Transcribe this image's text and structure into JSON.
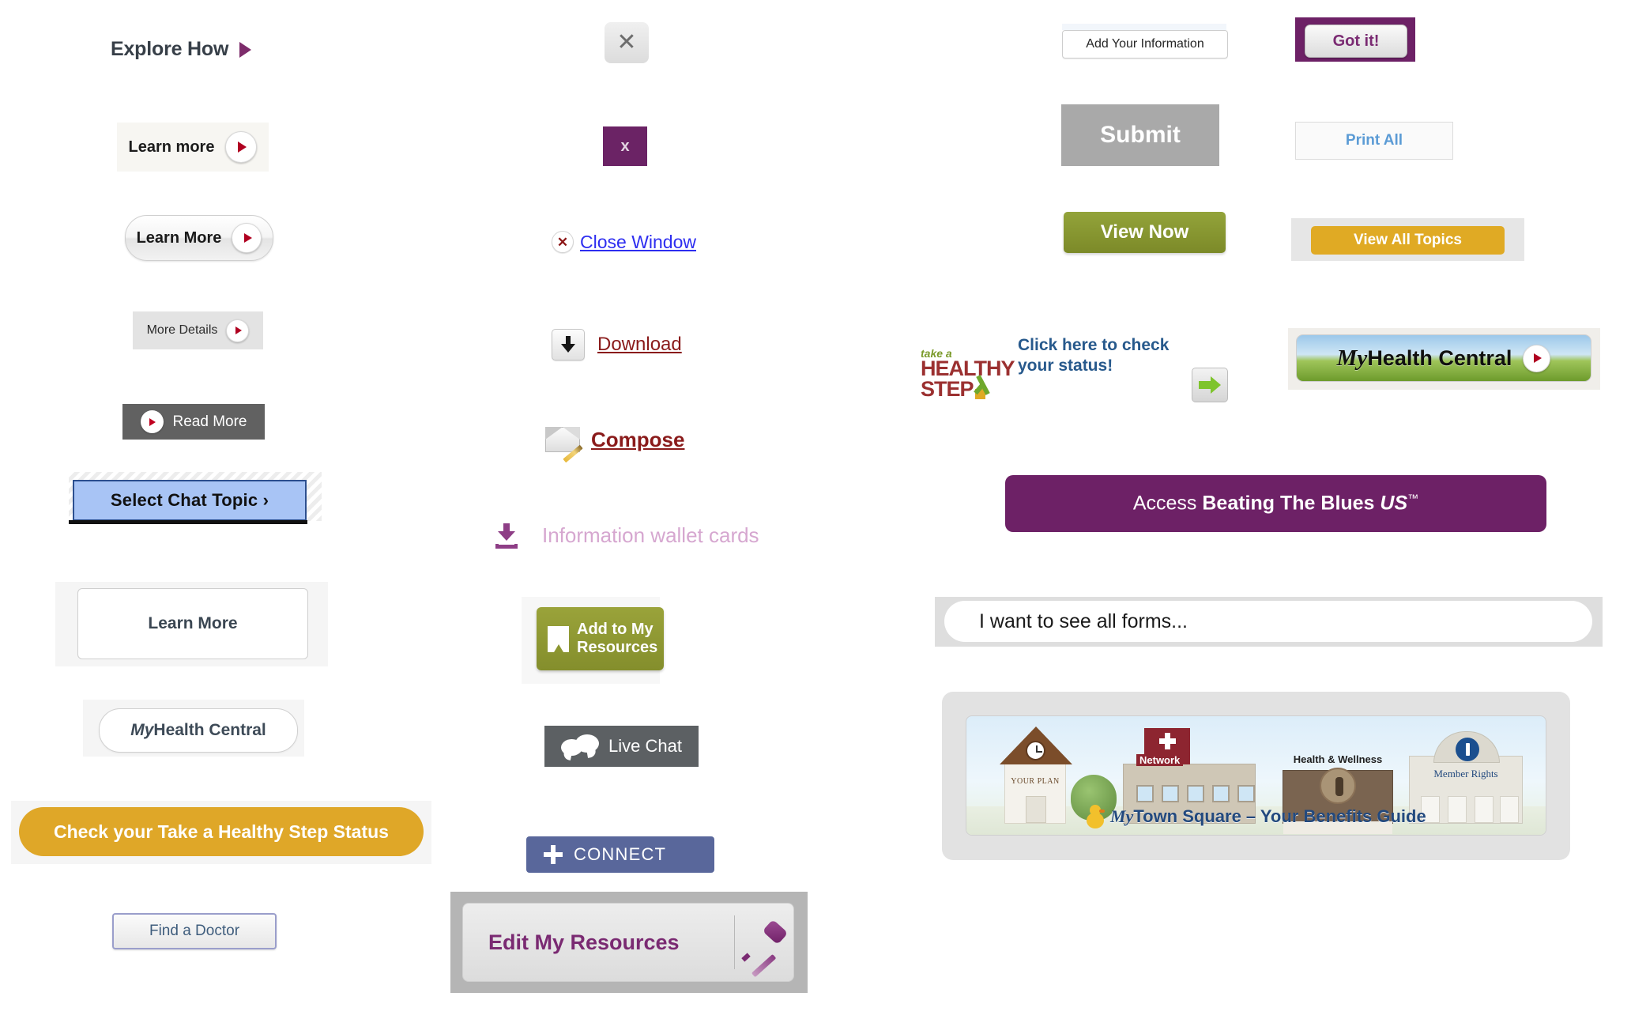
{
  "left_column": {
    "explore_how": {
      "label": "Explore How",
      "arrow_icon": "triangle-right-icon",
      "arrow_color": "#7d2c6b"
    },
    "learn_more_flat": {
      "label": "Learn more",
      "icon": "play-circle-icon",
      "bg": "#f7f6f2"
    },
    "learn_more_pill": {
      "label": "Learn More",
      "icon": "play-circle-icon"
    },
    "more_details": {
      "label": "More Details",
      "icon": "play-circle-icon",
      "bg": "#e3e3e3"
    },
    "read_more": {
      "label": "Read More",
      "icon": "play-circle-icon",
      "bg": "#616161"
    },
    "select_chat_topic": {
      "label": "Select Chat Topic ›",
      "bg": "#a8c4f5",
      "border": "#2c4f8f"
    },
    "learn_more_boxed": {
      "label": "Learn More"
    },
    "myhealth_central_pill": {
      "label_italic": "My",
      "label_rest": "Health Central"
    },
    "healthy_step_status": {
      "label": "Check your Take a Healthy Step Status",
      "bg": "#dfa728"
    },
    "find_a_doctor": {
      "label": "Find a Doctor",
      "border": "#9a9ecb",
      "text_color": "#3f5d7d"
    }
  },
  "middle_column": {
    "close_grey": {
      "label": "✕",
      "icon": "close-icon"
    },
    "close_purple": {
      "label": "x",
      "icon": "close-icon",
      "bg": "#6b2365"
    },
    "close_window_link": {
      "label": "Close Window",
      "icon": "close-circle-icon",
      "color": "#2d2df0"
    },
    "download_link": {
      "label": "Download",
      "icon": "download-arrow-icon",
      "color": "#8a1b1b"
    },
    "compose_link": {
      "label": "Compose",
      "icon": "envelope-pencil-icon",
      "color": "#8a1b1b"
    },
    "wallet_cards_link": {
      "label": "Information wallet cards",
      "icon": "download-tray-icon",
      "color": "#d6a7d0"
    },
    "add_to_my_resources": {
      "label_line1": "Add to My",
      "label_line2": "Resources",
      "icon": "bookmark-icon",
      "bg": "#8c9630"
    },
    "live_chat": {
      "label": "Live Chat",
      "icon": "chat-bubbles-icon",
      "bg": "#5c6063"
    },
    "connect": {
      "label": "CONNECT",
      "icon": "plus-icon",
      "bg": "#59679b"
    },
    "edit_my_resources": {
      "label": "Edit My Resources",
      "icon": "screwdriver-icon",
      "text_color": "#7a2a72"
    }
  },
  "right_column": {
    "add_your_information": {
      "label": "Add Your Information"
    },
    "got_it": {
      "label": "Got it!",
      "wrapper_bg": "#6d2166",
      "text_color": "#7a2a72"
    },
    "submit": {
      "label": "Submit",
      "bg": "#a9a9a9"
    },
    "print_all": {
      "label": "Print All",
      "text_color": "#5b9bd5"
    },
    "view_now": {
      "label": "View Now",
      "bg": "#7c8a28"
    },
    "view_all_topics": {
      "label": "View All Topics",
      "bg": "#e0aa24"
    },
    "healthy_step_promo": {
      "logo_take_a": "take a",
      "logo_healthy": "HEALTHY",
      "logo_step": "STEP",
      "message": "Click here to check your status!",
      "message_color": "#27598c",
      "arrow_icon": "arrow-right-icon"
    },
    "myhealth_central_banner": {
      "label_italic": "My",
      "label_rest": "Health Central",
      "icon": "play-circle-icon"
    },
    "beating_the_blues": {
      "prefix": "Access ",
      "bold": "Beating The Blues ",
      "italic": "US",
      "tm": "™",
      "bg": "#6d2166"
    },
    "forms_input": {
      "value": "I want to see all forms...",
      "placeholder": "I want to see all forms..."
    },
    "mytown_square_banner": {
      "caption_italic": "My",
      "caption_rest": "Town Square – Your Benefits Guide",
      "building_your_plan": "YOUR PLAN",
      "building_network": "Network",
      "building_health_wellness": "Health & Wellness",
      "building_member_rights": "Member Rights"
    }
  }
}
